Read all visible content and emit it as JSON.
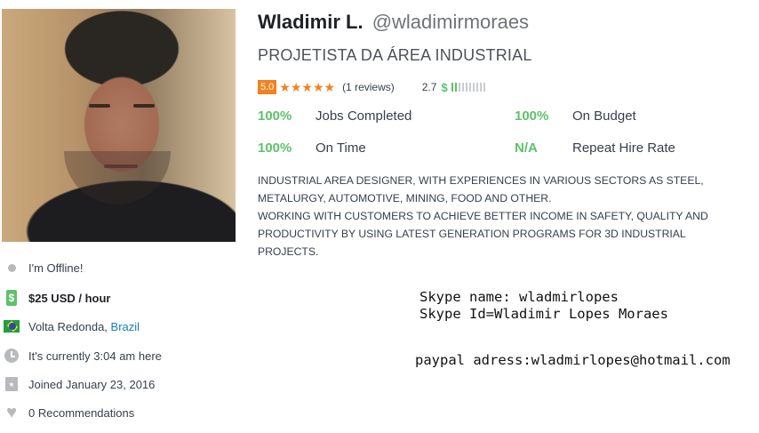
{
  "profile": {
    "name": "Wladimir L.",
    "handle": "@wladimirmoraes",
    "headline": "PROJETISTA DA ÁREA INDUSTRIAL",
    "rating": "5.0",
    "stars": "★★★★★",
    "reviews": "(1 reviews)",
    "earnings_score": "2.7",
    "earnings_symbol": "$",
    "earnings_bars_filled": 2,
    "earnings_bars_total": 10
  },
  "stats": [
    {
      "value": "100%",
      "label": "Jobs Completed"
    },
    {
      "value": "100%",
      "label": "On Budget"
    },
    {
      "value": "100%",
      "label": "On Time"
    },
    {
      "value": "N/A",
      "label": "Repeat Hire Rate"
    }
  ],
  "summary": {
    "para1": "INDUSTRIAL AREA DESIGNER, WITH EXPERIENCES IN VARIOUS SECTORS AS STEEL, METALURGY, AUTOMOTIVE, MINING, FOOD AND OTHER.",
    "para2": "WORKING WITH CUSTOMERS TO ACHIEVE BETTER INCOME IN SAFETY, QUALITY AND PRODUCTIVITY BY USING LATEST GENERATION PROGRAMS FOR 3D INDUSTRIAL PROJECTS."
  },
  "sidebar": {
    "status": "I'm Offline!",
    "rate": "$25 USD / hour",
    "money_icon_glyph": "$",
    "city": "Volta Redonda,",
    "country": "Brazil",
    "local_time": "It's currently 3:04 am here",
    "joined": "Joined January 23, 2016",
    "recommendations": "0 Recommendations"
  },
  "contact": {
    "skype_name": "Skype name: wladmirlopes",
    "skype_id": "Skype Id=Wladimir Lopes Moraes",
    "paypal": "paypal adress:wladmirlopes@hotmail.com"
  },
  "colors": {
    "accent_orange": "#f4811f",
    "success_green": "#5dc26a",
    "link_blue": "#1a7cc2",
    "icon_gray": "#b7b9bd"
  },
  "icons": {
    "status": "offline-dot-icon",
    "rate": "money-icon",
    "location": "brazil-flag-icon",
    "time": "clock-icon",
    "joined": "calendar-icon",
    "recommendations": "heart-icon"
  }
}
